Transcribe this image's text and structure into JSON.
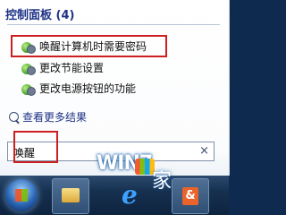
{
  "start_menu": {
    "heading": "控制面板 (4)",
    "results": [
      {
        "label": "唤醒计算机时需要密码",
        "icon": "control-panel-icon"
      },
      {
        "label": "更改节能设置",
        "icon": "control-panel-icon"
      },
      {
        "label": "更改电源按钮的功能",
        "icon": "control-panel-icon"
      }
    ],
    "see_more": "查看更多结果",
    "search": {
      "value": "唤醒",
      "clear": "×"
    }
  },
  "taskbar": {
    "start": "windows-start-orb",
    "items": [
      "windows-explorer",
      "internet-explorer",
      "app"
    ]
  },
  "watermark": {
    "text": "WIN7",
    "suffix": "家"
  },
  "colors": {
    "accent": "#1e3287",
    "highlight_border": "#cc1f1f",
    "taskbar": "#16304f"
  }
}
